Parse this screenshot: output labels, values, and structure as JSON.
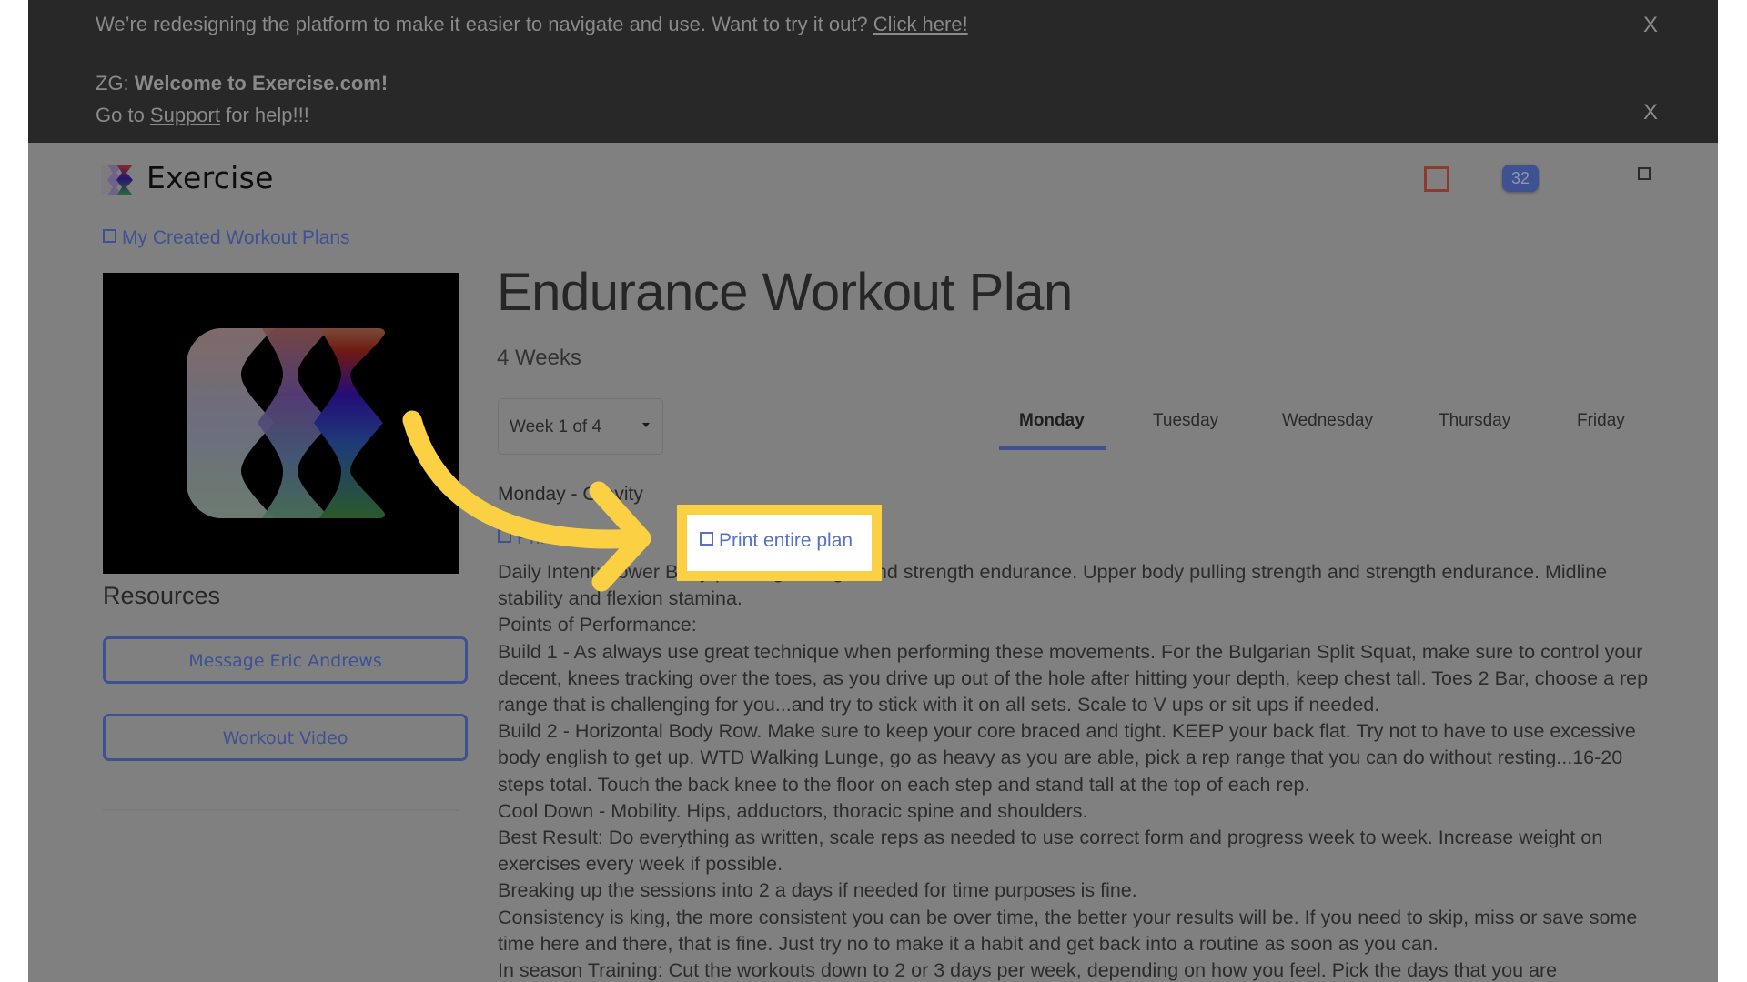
{
  "banner": {
    "redesign_text": "We’re redesigning the platform to make it easier to navigate and use. Want to try it out? ",
    "redesign_link": "Click here!",
    "welcome_prefix": "ZG: ",
    "welcome_bold": "Welcome to Exercise.com!",
    "support_prefix": "Go to ",
    "support_link": "Support",
    "support_suffix": " for help!!!",
    "close_label": "X"
  },
  "header": {
    "brand": "Exercise",
    "badge_count": "32",
    "colors": {
      "accent": "#3e5192",
      "alert": "#8e3a2c"
    }
  },
  "sidebar": {
    "back_link": "My Created Workout Plans",
    "resources_title": "Resources",
    "buttons": [
      "Message Eric Andrews",
      "Workout Video"
    ]
  },
  "plan": {
    "title": "Endurance Workout Plan",
    "duration": "4 Weeks",
    "week_select": "Week 1 of 4",
    "tabs": [
      "Monday",
      "Tuesday",
      "Wednesday",
      "Thursday",
      "Friday"
    ],
    "active_tab": "Monday",
    "day_heading": "Monday - Gravity",
    "print_workout": "Print workout",
    "print_plan": "Print entire plan",
    "body": [
      "Daily Intent: Lower Body pushing strength and strength endurance. Upper body pulling strength and strength endurance. Midline stability and flexion stamina.",
      "Points of Performance:",
      "Build 1 - As always use great technique when performing these movements. For the Bulgarian Split Squat, make sure to control your decent, knees tracking over the toes, as you drive up out of the hole after hitting your depth, keep chest tall. Toes 2 Bar, choose a rep range that is challenging for you...and try to stick with it on all sets. Scale to V ups or sit ups if needed.",
      "Build 2 - Horizontal Body Row. Make sure to keep your core braced and tight. KEEP your back flat. Try not to have to use excessive body english to get up. WTD Walking Lunge, go as heavy as you are able, pick a rep range that you can do without resting...16-20 steps total. Touch the back knee to the floor on each step and stand tall at the top of each rep.",
      "Cool Down - Mobility. Hips, adductors, thoracic spine and shoulders.",
      "Best Result: Do everything as written, scale reps as needed to use correct form and progress week to week. Increase weight on exercises every week if possible.",
      "Breaking up the sessions into 2 a days if needed for time purposes is fine.",
      "Consistency is king, the more consistent you can be over time, the better your results will be. If you need to skip, miss or save some time here and there, that is fine. Just try no to make it a habit and get back into a routine as soon as you can.",
      "In season Training: Cut the workouts down to 2 or 3 days per week, depending on how you feel. Pick the days that you are"
    ]
  },
  "annotation": {
    "highlight_color": "#fcd043"
  }
}
